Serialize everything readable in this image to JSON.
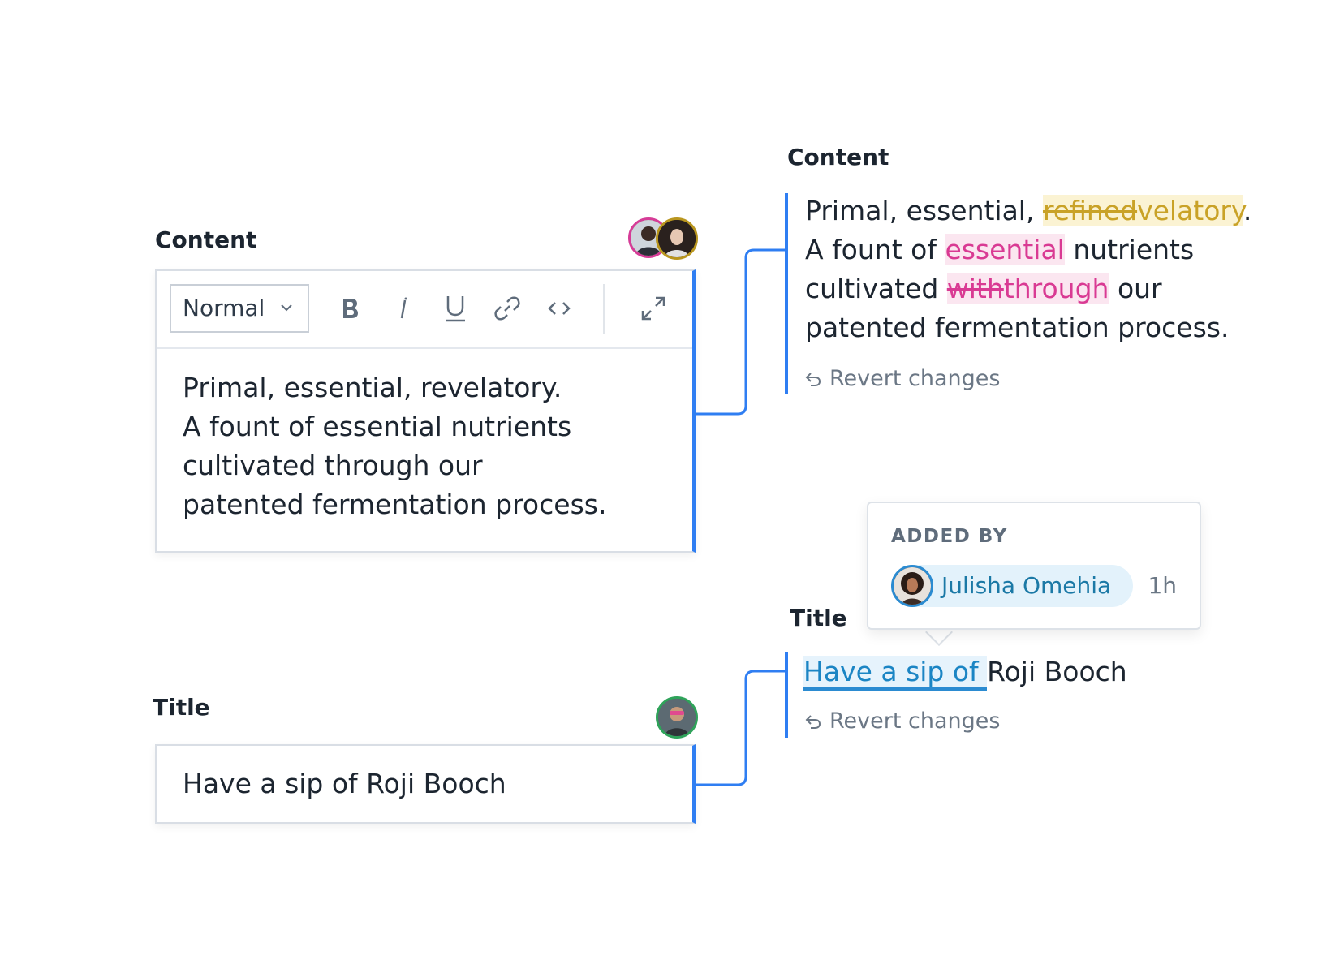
{
  "left": {
    "content_label": "Content",
    "editor": {
      "format_select": "Normal",
      "toolbar_buttons": [
        "bold",
        "italic",
        "underline",
        "link",
        "code",
        "expand"
      ],
      "body_lines": [
        "Primal, essential, revelatory.",
        "A fount of essential nutrients",
        "cultivated through our",
        "patented fermentation process."
      ]
    },
    "title_label": "Title",
    "title_value": "Have a sip of Roji Booch"
  },
  "right": {
    "content_label": "Content",
    "content_diff": {
      "line1_prefix": "Primal, essential, ",
      "line1_removed": "refined",
      "line1_added": "velatory",
      "line1_suffix": ".",
      "line2_prefix": "A fount of ",
      "line2_added": "essential",
      "line2_suffix": " nutrients",
      "line3_prefix": "cultivated ",
      "line3_removed": "with",
      "line3_added": "through",
      "line3_suffix": " our",
      "line4": "patented fermentation process."
    },
    "revert_label": "Revert changes",
    "title_label": "Title",
    "title_diff": {
      "added": "Have a sip of ",
      "rest": "Roji Booch"
    },
    "title_revert_label": "Revert changes"
  },
  "popover": {
    "heading": "ADDED BY",
    "user_name": "Julisha Omehia",
    "time": "1h"
  },
  "colors": {
    "accent_blue": "#2f7ef2",
    "highlight_yellow": "#c9a227",
    "highlight_pink": "#d93a93",
    "added_blue": "#1b85c4"
  }
}
